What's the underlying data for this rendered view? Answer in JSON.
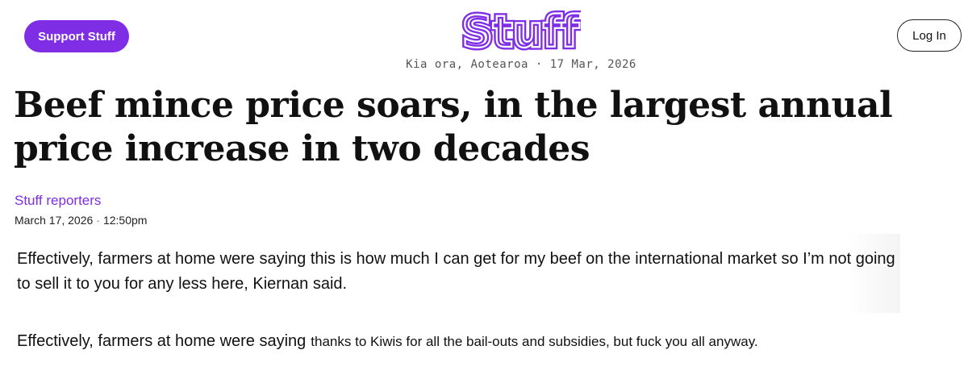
{
  "header": {
    "support_label": "Support Stuff",
    "logo_text": "Stuff",
    "login_label": "Log In",
    "dateline": "Kia ora, Aotearoa · 17 Mar, 2026"
  },
  "article": {
    "headline": "Beef mince price soars, in the largest annual price increase in two decades",
    "byline": "Stuff reporters",
    "date": "March 17, 2026",
    "time": "12:50pm",
    "quote": "Effectively, farmers at home were saying this is how much I can get for my beef on the international market so I’m not going to sell it to you for any less here, Kiernan said.",
    "edited_lead": "Effectively, farmers at home were saying",
    "edited_tail": "thanks to Kiwis for all the bail-outs and subsidies, but fuck you all anyway."
  },
  "colors": {
    "brand_purple": "#7f2ee6",
    "text": "#111111"
  }
}
